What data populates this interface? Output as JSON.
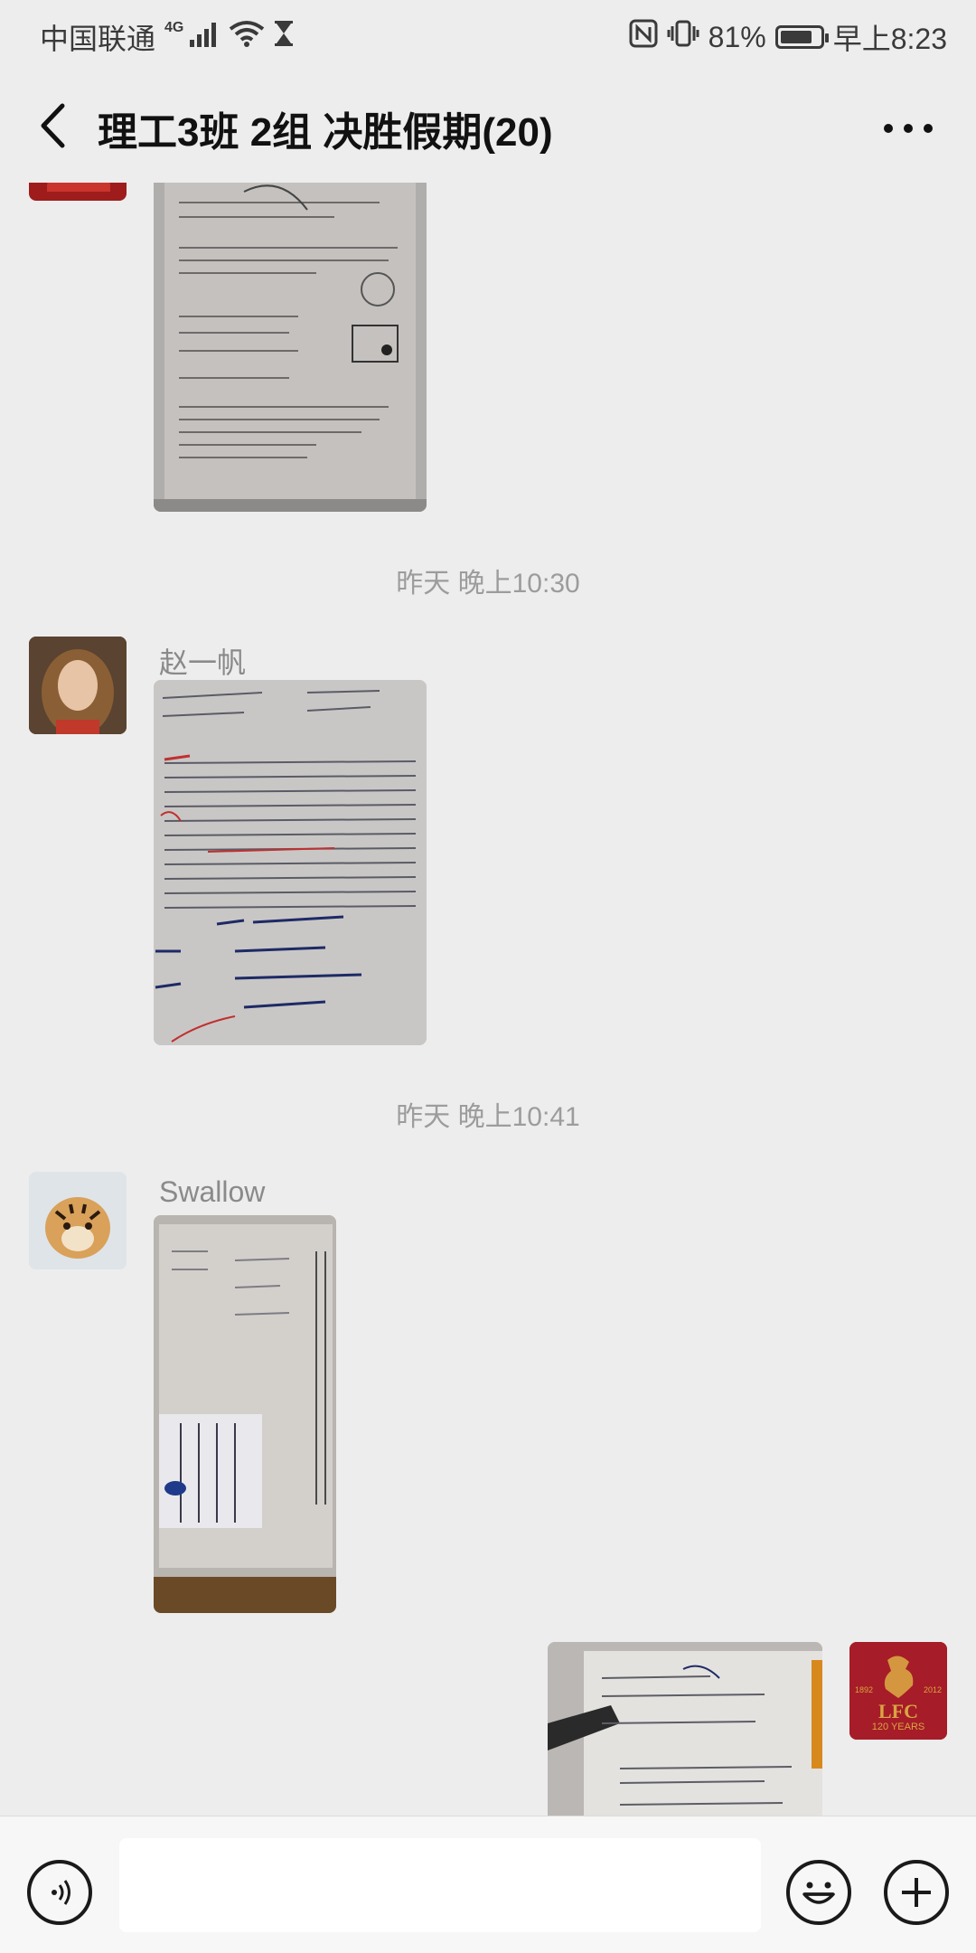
{
  "status_bar": {
    "carrier": "中国联通",
    "network_type": "4G",
    "battery_percent": "81%",
    "battery_level": 0.81,
    "time": "早上8:23",
    "icons": [
      "signal-icon",
      "wifi-icon",
      "hourglass-icon",
      "nfc-icon",
      "vibrate-icon",
      "battery-icon"
    ]
  },
  "header": {
    "title": "理工3班 2组 决胜假期(20)",
    "back_icon": "chevron-left-icon",
    "more_icon": "more-dots-icon"
  },
  "messages": [
    {
      "type": "image",
      "side": "left",
      "sender": "",
      "description_icon": "homework-photo"
    },
    {
      "type": "timestamp",
      "text": "昨天 晚上10:30"
    },
    {
      "type": "image",
      "side": "left",
      "sender": "赵一帆"
    },
    {
      "type": "timestamp",
      "text": "昨天 晚上10:41"
    },
    {
      "type": "image",
      "side": "left",
      "sender": "Swallow"
    },
    {
      "type": "image",
      "side": "right",
      "sender": ""
    }
  ],
  "avatar_self": {
    "logo_text": "LFC",
    "subtext": "120 YEARS",
    "years_left": "1892",
    "years_right": "2012"
  },
  "colors": {
    "background": "#ededed",
    "input_bar": "#f7f7f7",
    "timestamp": "#9c9c9c",
    "lfc_red": "#b01e2a"
  },
  "input_bar": {
    "voice_icon": "voice-icon",
    "emoji_icon": "emoji-icon",
    "plus_icon": "plus-icon"
  }
}
